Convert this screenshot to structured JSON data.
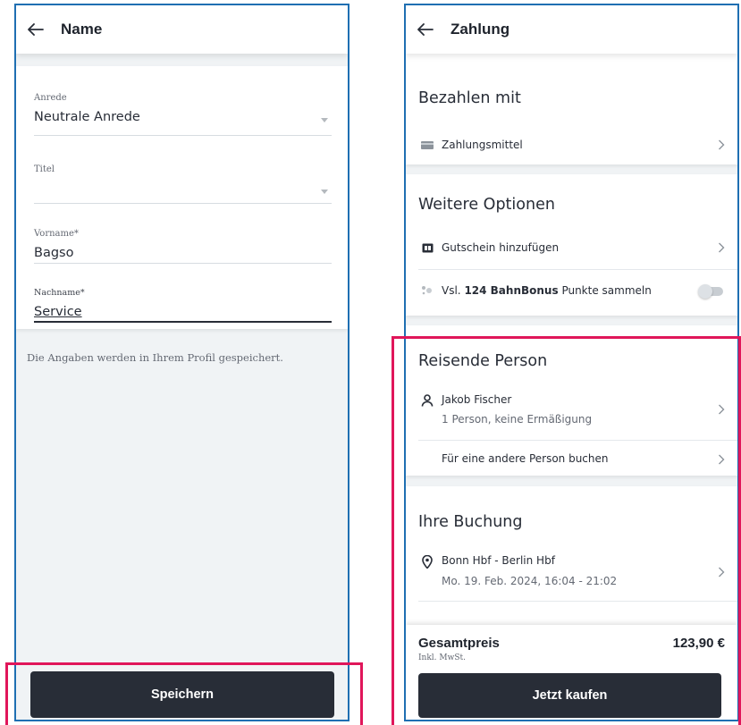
{
  "name_screen": {
    "title": "Name",
    "fields": {
      "salutation": {
        "label": "Anrede",
        "value": "Neutrale Anrede"
      },
      "title": {
        "label": "Titel",
        "value": ""
      },
      "first_name": {
        "label": "Vorname*",
        "value": "Bagso"
      },
      "last_name": {
        "label": "Nachname*",
        "value": "Service"
      }
    },
    "hint": "Die Angaben werden in Ihrem Profil gespeichert.",
    "save_label": "Speichern"
  },
  "payment_screen": {
    "title": "Zahlung",
    "pay_with": {
      "heading": "Bezahlen mit",
      "method_label": "Zahlungsmittel"
    },
    "options": {
      "heading": "Weitere Optionen",
      "voucher_label": "Gutschein hinzufügen",
      "bonus_prefix": "Vsl. ",
      "bonus_bold": "124 BahnBonus",
      "bonus_suffix": " Punkte sammeln"
    },
    "traveler": {
      "heading": "Reisende Person",
      "name": "Jakob Fischer",
      "details": "1 Person, keine Ermäßigung",
      "other_person": "Für eine andere Person buchen"
    },
    "booking": {
      "heading": "Ihre Buchung",
      "route": "Bonn Hbf - Berlin Hbf",
      "datetime": "Mo. 19. Feb. 2024, 16:04 - 21:02"
    },
    "total": {
      "label": "Gesamtpreis",
      "value": "123,90 €",
      "vat_note": "Inkl. MwSt."
    },
    "buy_label": "Jetzt kaufen"
  },
  "colors": {
    "frame": "#1f6fb2",
    "highlight": "#e0165a",
    "button": "#282d37"
  }
}
